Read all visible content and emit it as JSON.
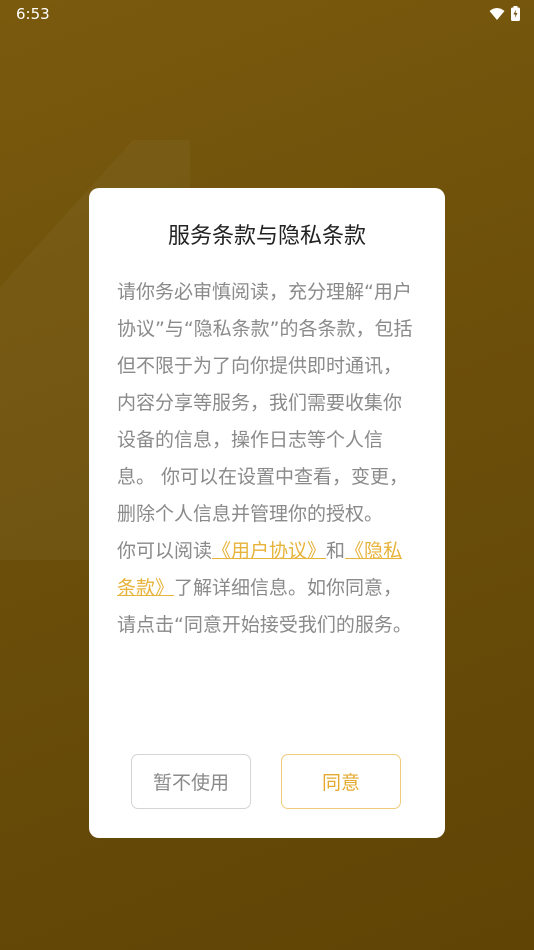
{
  "status_bar": {
    "time": "6:53"
  },
  "dialog": {
    "title": "服务条款与隐私条款",
    "paragraph1": "请你务必审慎阅读，充分理解“用户协议”与“隐私条款”的各条款，包括但不限于为了向你提供即时通讯，内容分享等服务，我们需要收集你设备的信息，操作日志等个人信息。 你可以在设置中查看，变更，删除个人信息并管理你的授权。",
    "paragraph2_prefix": "你可以阅读",
    "link_user_agreement": "《用户协议》",
    "paragraph2_and": "和",
    "link_privacy": "《隐私条款》",
    "paragraph2_suffix": "了解详细信息。如你同意，请点击“同意开始接受我们的服务。",
    "decline_label": "暂不使用",
    "agree_label": "同意",
    "accent_color": "#e7b33a"
  }
}
